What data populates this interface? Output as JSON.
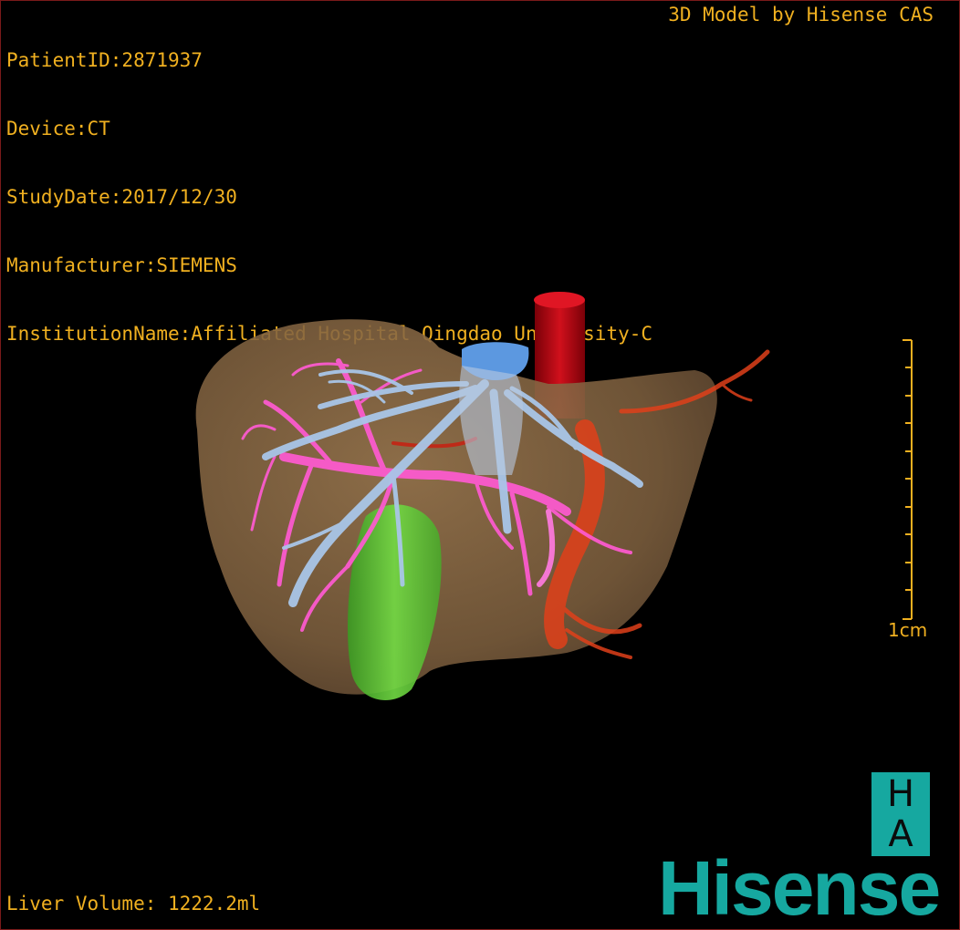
{
  "patient_info": {
    "patient_id": "PatientID:2871937",
    "device": "Device:CT",
    "study_date": "StudyDate:2017/12/30",
    "manufacturer": "Manufacturer:SIEMENS",
    "institution": "InstitutionName:Affiliated Hospital Qingdao University-C"
  },
  "brand_caption": "3D Model by Hisense CAS",
  "liver_volume": "Liver Volume: 1222.2ml",
  "scale_bar": {
    "label": "1cm"
  },
  "logo": {
    "letter_top": "H",
    "letter_bottom": "A",
    "wordmark": "Hisense"
  },
  "colors": {
    "overlay_text": "#f0b020",
    "brand_teal": "#16a8a0",
    "liver": "#8a6a45",
    "portal_vein": "#ff5ad2",
    "hepatic_vein": "#a9c6e8",
    "artery": "#e0401a",
    "vena_cava": "#c00010",
    "gallbladder": "#5ec832"
  }
}
